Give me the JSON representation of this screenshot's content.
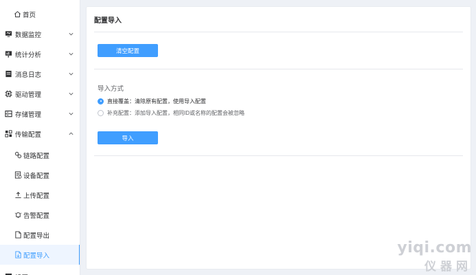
{
  "sidebar": {
    "items": [
      {
        "label": "首页",
        "icon": "home-icon"
      },
      {
        "label": "数据监控",
        "icon": "monitor-icon"
      },
      {
        "label": "统计分析",
        "icon": "chart-icon"
      },
      {
        "label": "消息日志",
        "icon": "log-icon"
      },
      {
        "label": "驱动管理",
        "icon": "chip-icon"
      },
      {
        "label": "存储管理",
        "icon": "storage-icon"
      },
      {
        "label": "传输配置",
        "icon": "transfer-icon"
      }
    ],
    "sub_items": [
      {
        "label": "链路配置",
        "icon": "link-icon"
      },
      {
        "label": "设备配置",
        "icon": "device-icon"
      },
      {
        "label": "上传配置",
        "icon": "upload-icon"
      },
      {
        "label": "告警配置",
        "icon": "alarm-icon"
      },
      {
        "label": "配置导出",
        "icon": "export-icon"
      },
      {
        "label": "配置导入",
        "icon": "import-icon"
      }
    ],
    "active": "配置导入",
    "partial_bottom_label": "设置"
  },
  "panel": {
    "title": "配置导入",
    "clear_button": "清空配置",
    "import_mode_label": "导入方式",
    "options": [
      {
        "label": "直接覆盖：清除原有配置，使用导入配置",
        "checked": true
      },
      {
        "label": "补充配置：添加导入配置，相同ID或名称的配置会被忽略",
        "checked": false
      }
    ],
    "import_button": "导入"
  },
  "watermark": {
    "line1": "yiqi.com",
    "line2": "仪器网"
  },
  "colors": {
    "accent": "#409eff",
    "active_bg": "#eef5ff",
    "page_bg": "#eef1f6"
  }
}
